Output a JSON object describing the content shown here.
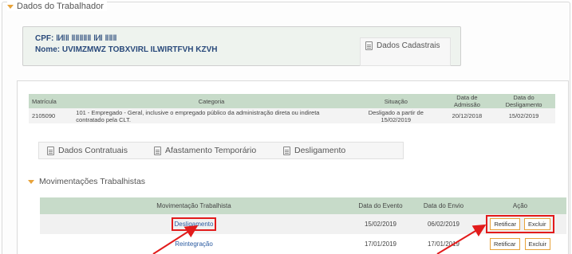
{
  "section": {
    "title": "Dados do Trabalhador"
  },
  "worker": {
    "cpf_label": "CPF:",
    "cpf_value": "‖∕‖‖ ‖‖‖‖‖ ‖∕‖ ‖‖‖",
    "nome_label": "Nome:",
    "nome_value": "UVIMZMWZ TOBXVIRL ILWIRTFVH KZVH",
    "cadastrais_button": "Dados Cadastrais"
  },
  "contract_table": {
    "headers": [
      "Matrícula",
      "Categoria",
      "Situação",
      "Data de Admissão",
      "Data do Desligamento"
    ],
    "rows": [
      [
        "2105090",
        "101 - Empregado - Geral, inclusive o empregado público da administração direta ou indireta contratado pela CLT.",
        "Desligado a partir de 15/02/2019",
        "20/12/2018",
        "15/02/2019"
      ]
    ]
  },
  "tabs": [
    {
      "label": "Dados Contratuais",
      "icon": "contract-icon"
    },
    {
      "label": "Afastamento Temporário",
      "icon": "leave-icon"
    },
    {
      "label": "Desligamento",
      "icon": "termination-icon"
    }
  ],
  "movimentacoes": {
    "title": "Movimentações Trabalhistas",
    "headers": [
      "Movimentação Trabalhista",
      "Data do Evento",
      "Data do Envio",
      "Ação"
    ],
    "rows": [
      {
        "tipo": "Desligamento",
        "evento": "15/02/2019",
        "envio": "06/02/2019",
        "retificar": "Retificar",
        "excluir": "Excluir"
      },
      {
        "tipo": "Reintegração",
        "evento": "17/01/2019",
        "envio": "17/01/2019",
        "retificar": "Retificar",
        "excluir": "Excluir"
      }
    ]
  },
  "colors": {
    "highlight": "#e21b1b",
    "header_green": "#c7dbc9",
    "accent_orange": "#e8a33a",
    "link_blue": "#2a5aa0"
  }
}
